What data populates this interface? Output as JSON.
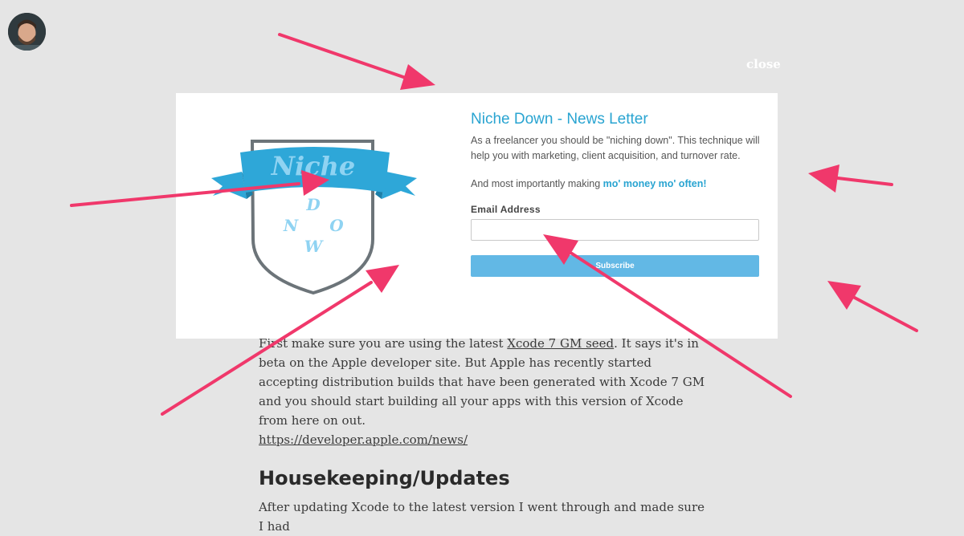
{
  "close_label": "close",
  "newsletter": {
    "title": "Niche Down - News Letter",
    "description": "As a freelancer you should be \"niching down\". This technique will help you with marketing, client acquisition, and turnover rate.",
    "emphasis_prefix": "And most importantly making ",
    "emphasis_highlight": "mo' money mo' often!",
    "email_label": "Email Address",
    "email_value": "",
    "subscribe_label": "Subscribe"
  },
  "logo": {
    "ribbon_text": "Niche",
    "letters": [
      "D",
      "N",
      "O",
      "W"
    ]
  },
  "article": {
    "para1_prefix": "First make sure you are using the latest ",
    "para1_link": "Xcode 7 GM seed",
    "para1_suffix": ". It says it's in beta on the Apple developer site. But Apple has recently started accepting distribution builds that have been generated with Xcode 7 GM and you should start building all your apps with this version of Xcode from here on out.",
    "link": "https://developer.apple.com/news/",
    "heading": "Housekeeping/Updates",
    "para2": "After updating Xcode to the latest version I went through and made sure I had"
  },
  "colors": {
    "accent": "#29a4d1",
    "button": "#62b8e5",
    "arrow": "#f0386b",
    "overlay": "#e5e5e5"
  }
}
